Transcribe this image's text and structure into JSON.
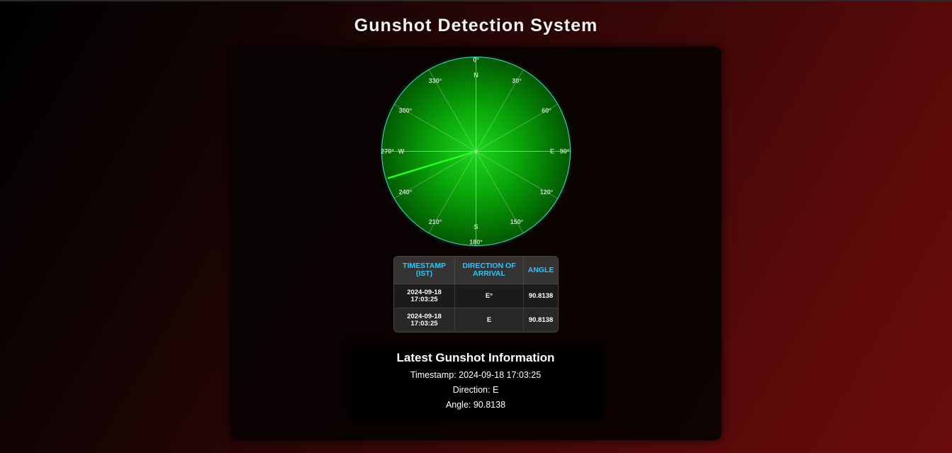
{
  "title": "Gunshot Detection System",
  "radar": {
    "degree_labels": [
      {
        "text": "0°",
        "angle": 0
      },
      {
        "text": "30°",
        "angle": 30
      },
      {
        "text": "60°",
        "angle": 60
      },
      {
        "text": "90°",
        "angle": 90
      },
      {
        "text": "120°",
        "angle": 120
      },
      {
        "text": "150°",
        "angle": 150
      },
      {
        "text": "180°",
        "angle": 180
      },
      {
        "text": "210°",
        "angle": 210
      },
      {
        "text": "240°",
        "angle": 240
      },
      {
        "text": "270°",
        "angle": 270
      },
      {
        "text": "300°",
        "angle": 300
      },
      {
        "text": "330°",
        "angle": 330
      }
    ],
    "cardinals": {
      "north": "N",
      "east": "E",
      "south": "S",
      "west": "W"
    },
    "needle_angle": 253,
    "colors": {
      "face": "#00b400",
      "needle": "#22ff22",
      "rim": "#3fe0c0"
    }
  },
  "table": {
    "headers": [
      "Timestamp (IST)",
      "Direction of Arrival",
      "Angle"
    ],
    "rows": [
      {
        "timestamp": "2024-09-18 17:03:25",
        "direction": "E°",
        "angle": "90.8138"
      },
      {
        "timestamp": "2024-09-18 17:03:25",
        "direction": "E",
        "angle": "90.8138"
      }
    ]
  },
  "latest": {
    "heading": "Latest Gunshot Information",
    "timestamp_line": "Timestamp: 2024-09-18 17:03:25",
    "direction_line": "Direction: E",
    "angle_line": "Angle: 90.8138"
  }
}
